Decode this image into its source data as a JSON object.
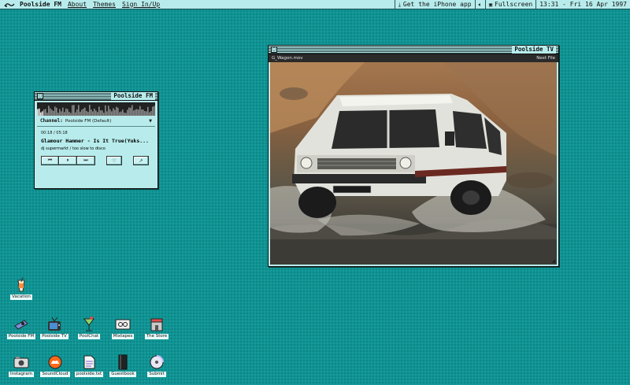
{
  "menubar": {
    "brand": "Poolside FM",
    "items": [
      "About",
      "Themes",
      "Sign In/Up"
    ],
    "iphone": "Get the iPhone app",
    "fullscreen": "Fullscreen",
    "clock": "13:31 - Fri 16 Apr 1997"
  },
  "fm": {
    "title": "Poolside FM",
    "channel_label": "Channel:",
    "channel_value": "Poolside FM (Default)",
    "time": "00:18 / 05:18",
    "track": "Glamour Hammer - Is It True(Yuks...",
    "artist": "dj supermarkt / too slow to disco",
    "progress": 0.057
  },
  "tv": {
    "title": "Poolside TV",
    "file": "G_Wagon.mov",
    "next": "Next File"
  },
  "icons": [
    {
      "id": "vacation",
      "label": "Vacation"
    },
    {
      "id": "poolside-fm",
      "label": "Poolside FM"
    },
    {
      "id": "poolside-tv",
      "label": "Poolside TV"
    },
    {
      "id": "poolchat",
      "label": "PoolChat"
    },
    {
      "id": "mixtapes",
      "label": "Mixtapes"
    },
    {
      "id": "the-store",
      "label": "The Store"
    },
    {
      "id": "instagram",
      "label": "Instagram"
    },
    {
      "id": "soundcloud",
      "label": "SoundCloud"
    },
    {
      "id": "poolside-txt",
      "label": "poolside.txt"
    },
    {
      "id": "guestbook",
      "label": "Guestbook"
    },
    {
      "id": "submit",
      "label": "Submit"
    }
  ],
  "colors": {
    "desktop": "#0f9494",
    "window": "#b8ecec",
    "text": "#111111"
  }
}
